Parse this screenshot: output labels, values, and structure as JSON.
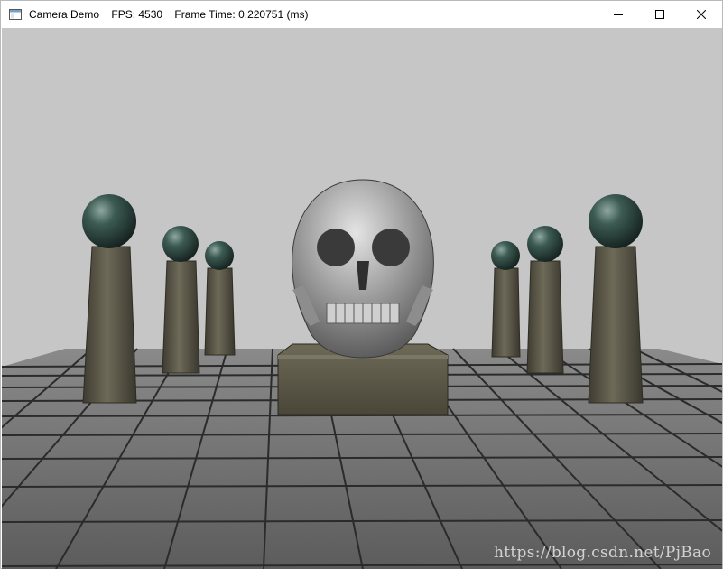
{
  "window": {
    "title": "Camera Demo    FPS: 4530    Frame Time: 0.220751 (ms)",
    "app_icon": "window-app-icon",
    "buttons": {
      "minimize_icon": "minimize-icon",
      "maximize_icon": "maximize-icon",
      "close_icon": "close-icon"
    }
  },
  "scene": {
    "background_color": "#c6c6c6",
    "floor_color": "#6e6e6e",
    "grid_line_color": "#2b2b2b",
    "objects": [
      "skull",
      "pedestal",
      "columns",
      "spheres",
      "tiled-floor"
    ],
    "sphere_color": "#2f4a44",
    "column_color": "#5d5a4c",
    "skull_color": "#9a9a9a"
  },
  "watermark": {
    "text": "https://blog.csdn.net/PjBao"
  }
}
